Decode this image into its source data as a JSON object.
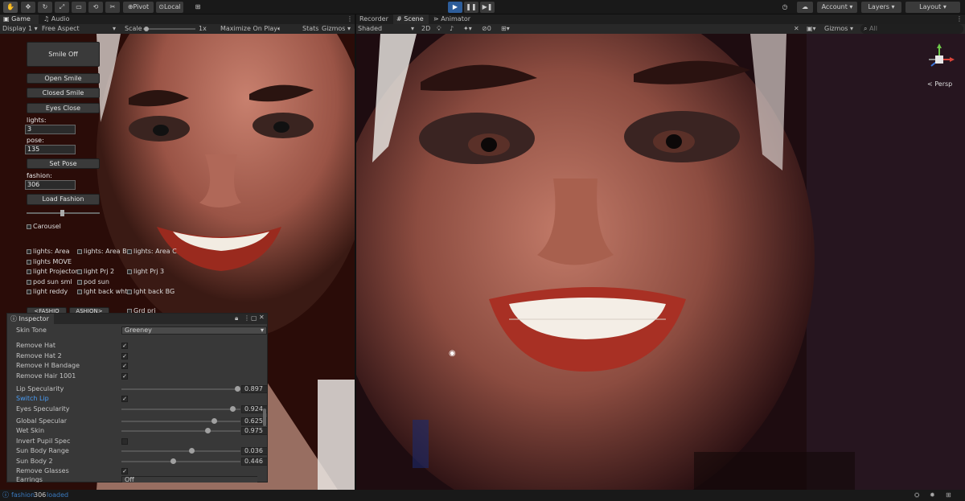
{
  "toolbar": {
    "pivot_label": "Pivot",
    "local_label": "Local",
    "account_label": "Account",
    "layers_label": "Layers",
    "layout_label": "Layout"
  },
  "left_tabs": {
    "game": "Game",
    "audio_mixer": "Audio Mixer"
  },
  "right_tabs": {
    "recorder": "Recorder",
    "scene": "Scene",
    "animator": "Animator"
  },
  "game_controls": {
    "display": "Display 1",
    "aspect": "Free Aspect",
    "scale_label": "Scale",
    "scale_value": "1x",
    "maximize": "Maximize On Play",
    "stats": "Stats",
    "gizmos": "Gizmos"
  },
  "scene_controls": {
    "shading": "Shaded",
    "mode_2d": "2D",
    "hidden_count": "0",
    "gizmos": "Gizmos",
    "search_placeholder": "All",
    "persp_label": "Persp"
  },
  "game_ui": {
    "smile_off": "Smile Off",
    "open_smile": "Open Smile",
    "closed_smile": "Closed Smile",
    "eyes_close": "Eyes Close",
    "lights_label": "lights:",
    "lights_value": "3",
    "pose_label": "pose:",
    "pose_value": "135",
    "set_pose": "Set Pose",
    "fashion_label": "fashion:",
    "fashion_value": "306",
    "load_fashion": "Load Fashion",
    "carousel": "Carousel",
    "toggles": [
      "lights: Area",
      "lights: Area B",
      "lights: Area C",
      "lights MOVE",
      "light Projector",
      "light Prj 2",
      "light Prj 3",
      "pod sun sml",
      "pod sun",
      "light reddy",
      "lght back wht",
      "lght back BG"
    ],
    "bottom_buttons": [
      "<FASHIO",
      "ASHION>"
    ],
    "bottom_toggle": "Grd pri"
  },
  "inspector": {
    "title": "Inspector",
    "skin_tone_label": "Skin Tone",
    "skin_tone_value": "Greeney",
    "rows": {
      "remove_hat": "Remove Hat",
      "remove_hat2": "Remove Hat 2",
      "remove_bandage": "Remove H Bandage",
      "remove_hair": "Remove Hair 1001",
      "lip_spec": "Lip Specularity",
      "lip_spec_val": "0.897",
      "switch_lip": "Switch Lip",
      "eyes_spec": "Eyes Specularity",
      "eyes_spec_val": "0.924",
      "global_spec": "Global Specular",
      "global_spec_val": "0.625",
      "wet_skin": "Wet Skin",
      "wet_skin_val": "0.975",
      "invert_pupil": "Invert Pupil Spec",
      "sun_body_range": "Sun Body Range",
      "sun_body_range_val": "0.036",
      "sun_body2": "Sun Body 2",
      "sun_body2_val": "0.446",
      "remove_glasses": "Remove Glasses",
      "earrings": "Earrings",
      "earrings_val": "Off"
    }
  },
  "status": {
    "text": "fashion",
    "count": "306",
    "suffix": "loaded"
  },
  "colors": {
    "accent_blue": "#2d5d9a",
    "link_blue": "#4a9cf4",
    "editor_bg": "#191919"
  }
}
